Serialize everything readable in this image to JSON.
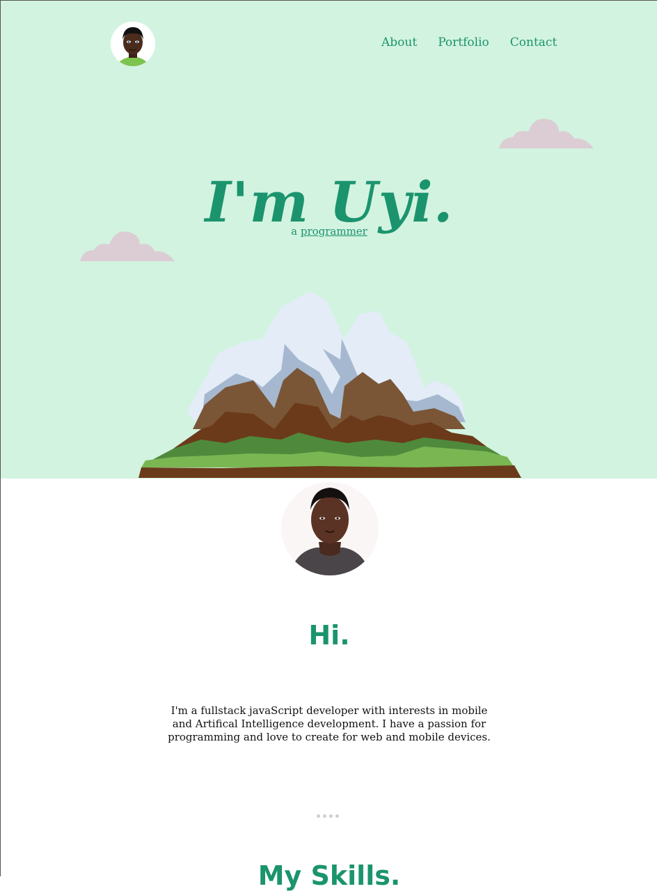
{
  "nav": {
    "items": [
      {
        "label": "About"
      },
      {
        "label": "Portfolio"
      },
      {
        "label": "Contact"
      }
    ]
  },
  "hero": {
    "title": "I'm Uyi.",
    "subtitle_prefix": "a ",
    "subtitle_role": "programmer"
  },
  "about": {
    "greeting": "Hi.",
    "bio": "I'm a fullstack javaScript developer with interests in mobile and Artifical Intelligence development. I have a passion for programming and love to create for web and mobile devices."
  },
  "skills": {
    "heading": "My Skills."
  },
  "colors": {
    "accent": "#1b946d",
    "hero_bg": "#d2f3e0",
    "cloud": "#dccdd4"
  }
}
